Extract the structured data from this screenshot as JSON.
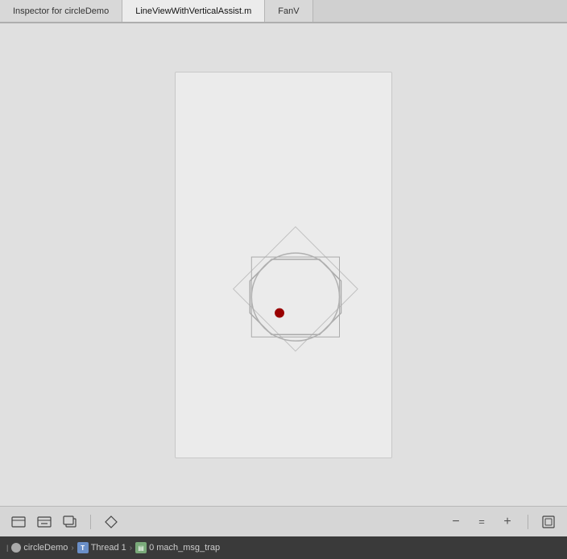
{
  "tabs": [
    {
      "id": "inspector",
      "label": "Inspector for circleDemo",
      "active": false
    },
    {
      "id": "lineview",
      "label": "LineViewWithVerticalAssist.m",
      "active": true
    },
    {
      "id": "fanview",
      "label": "FanV",
      "active": false
    }
  ],
  "toolbar": {
    "buttons": [
      {
        "id": "btn-add-view",
        "symbol": "⊞",
        "label": "Add View"
      },
      {
        "id": "btn-remove-view",
        "symbol": "⊟",
        "label": "Remove View"
      },
      {
        "id": "btn-clone",
        "symbol": "⧉",
        "label": "Clone"
      },
      {
        "id": "btn-object",
        "symbol": "◇",
        "label": "Object"
      },
      {
        "id": "btn-minus",
        "symbol": "−",
        "label": "Minus"
      },
      {
        "id": "btn-equals",
        "symbol": "=",
        "label": "Equals"
      },
      {
        "id": "btn-plus",
        "symbol": "+",
        "label": "Plus"
      },
      {
        "id": "btn-expand",
        "symbol": "⊡",
        "label": "Expand"
      }
    ]
  },
  "statusbar": {
    "breadcrumbs": [
      {
        "id": "app",
        "label": "circleDemo",
        "icon": "app-icon"
      },
      {
        "id": "thread",
        "label": "Thread 1",
        "icon": "thread-icon"
      },
      {
        "id": "frame",
        "label": "0 mach_msg_trap",
        "icon": "frame-icon"
      }
    ]
  },
  "canvas": {
    "octagon_stroke": "#aaaaaa",
    "circle_stroke": "#aaaaaa",
    "diamond_stroke": "#bbbbbb",
    "bounding_box_stroke": "#aaaaaa",
    "red_dot_fill": "#990000"
  }
}
